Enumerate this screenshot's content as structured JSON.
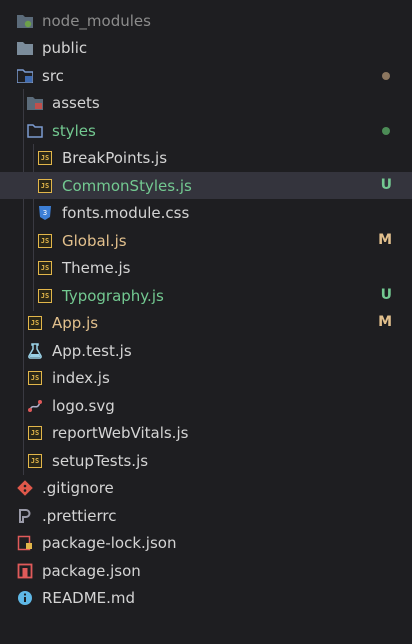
{
  "colors": {
    "background": "#1e1e21",
    "selected_row": "#34343d",
    "default_text": "#d4d4d4",
    "ignored_text": "#8c8c8c",
    "untracked_text": "#73c991",
    "modified_text": "#e2c08d",
    "folder_dot_modified": "#8c7760",
    "folder_dot_untracked": "#4c8c56"
  },
  "tree": [
    {
      "label": "node_modules",
      "icon": "folder-node-icon",
      "git": "ignored"
    },
    {
      "label": "public",
      "icon": "folder-icon",
      "git": "none"
    },
    {
      "label": "src",
      "icon": "folder-src-icon",
      "git": "none",
      "dot": "modified"
    },
    {
      "label": "assets",
      "icon": "folder-assets-icon",
      "git": "none"
    },
    {
      "label": "styles",
      "icon": "folder-open-icon",
      "git": "untracked",
      "dot": "untracked"
    },
    {
      "label": "BreakPoints.js",
      "icon": "js-file-icon",
      "git": "none"
    },
    {
      "label": "CommonStyles.js",
      "icon": "js-file-icon",
      "git": "untracked",
      "badge": "U",
      "selected": true
    },
    {
      "label": "fonts.module.css",
      "icon": "css-file-icon",
      "git": "none"
    },
    {
      "label": "Global.js",
      "icon": "js-file-icon",
      "git": "modified",
      "badge": "M"
    },
    {
      "label": "Theme.js",
      "icon": "js-file-icon",
      "git": "none"
    },
    {
      "label": "Typography.js",
      "icon": "js-file-icon",
      "git": "untracked",
      "badge": "U"
    },
    {
      "label": "App.js",
      "icon": "js-file-icon",
      "git": "modified",
      "badge": "M"
    },
    {
      "label": "App.test.js",
      "icon": "test-flask-icon",
      "git": "none"
    },
    {
      "label": "index.js",
      "icon": "js-file-icon",
      "git": "none"
    },
    {
      "label": "logo.svg",
      "icon": "svg-file-icon",
      "git": "none"
    },
    {
      "label": "reportWebVitals.js",
      "icon": "js-file-icon",
      "git": "none"
    },
    {
      "label": "setupTests.js",
      "icon": "js-file-icon",
      "git": "none"
    },
    {
      "label": ".gitignore",
      "icon": "git-icon",
      "git": "none"
    },
    {
      "label": ".prettierrc",
      "icon": "prettier-icon",
      "git": "none"
    },
    {
      "label": "package-lock.json",
      "icon": "package-lock-icon",
      "git": "none"
    },
    {
      "label": "package.json",
      "icon": "package-icon",
      "git": "none"
    },
    {
      "label": "README.md",
      "icon": "info-icon",
      "git": "none"
    }
  ]
}
